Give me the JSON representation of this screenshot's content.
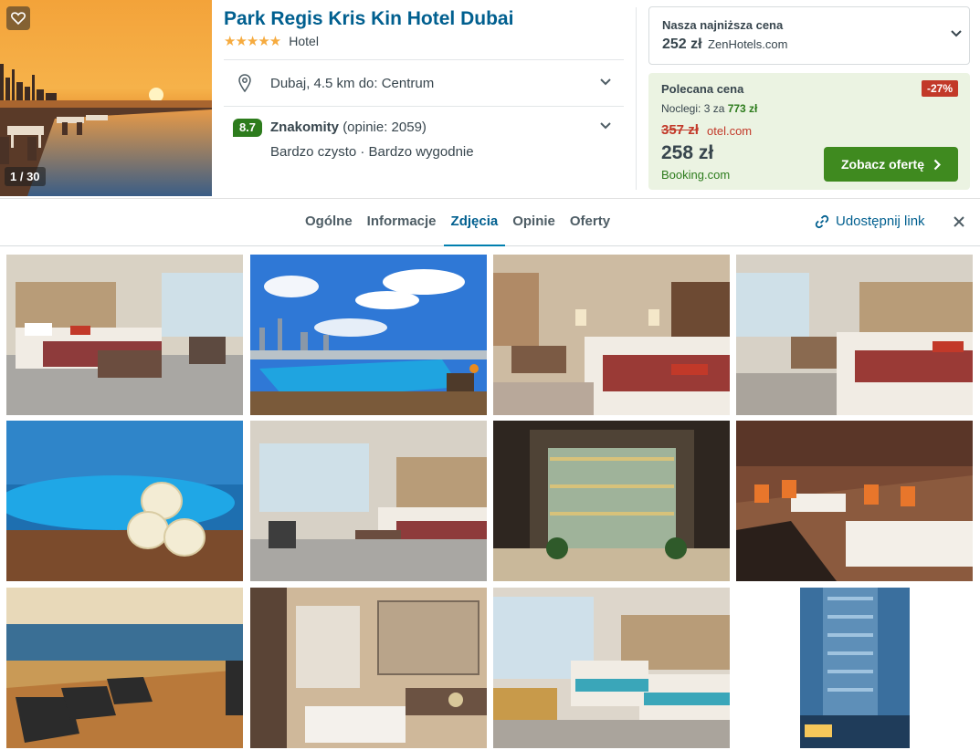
{
  "hero": {
    "counter": "1 / 30",
    "favorite_icon": "heart-outline-icon"
  },
  "hotel": {
    "name": "Park Regis Kris Kin Hotel Dubai",
    "stars": "★★★★★",
    "star_count": 5,
    "type": "Hotel",
    "location": "Dubaj, 4.5 km do: Centrum",
    "score": "8.7",
    "score_label": "Znakomity",
    "score_count": "(opinie: 2059)",
    "score_sub": "Bardzo czysto · Bardzo wygodnie"
  },
  "lowest_price": {
    "label": "Nasza najniższa cena",
    "price": "252 zł",
    "provider": "ZenHotels.com"
  },
  "deal": {
    "label": "Polecana cena",
    "discount": "-27%",
    "nights_prefix": "Noclegi: 3 za ",
    "nights_total": "773 zł",
    "old_price": "357 zł",
    "old_provider": "otel.com",
    "new_price": "258 zł",
    "new_provider": "Booking.com",
    "cta": "Zobacz ofertę"
  },
  "tabs": [
    {
      "label": "Ogólne"
    },
    {
      "label": "Informacje"
    },
    {
      "label": "Zdjęcia"
    },
    {
      "label": "Opinie"
    },
    {
      "label": "Oferty"
    }
  ],
  "active_tab": "Zdjęcia",
  "share_label": "Udostępnij link",
  "colors": {
    "brand_blue": "#005f8f",
    "score_green": "#2d7c1d",
    "cta_green": "#3f8a1f",
    "discount_red": "#c23929",
    "deal_bg": "#ebf3e2",
    "star": "#f6ab3f"
  }
}
